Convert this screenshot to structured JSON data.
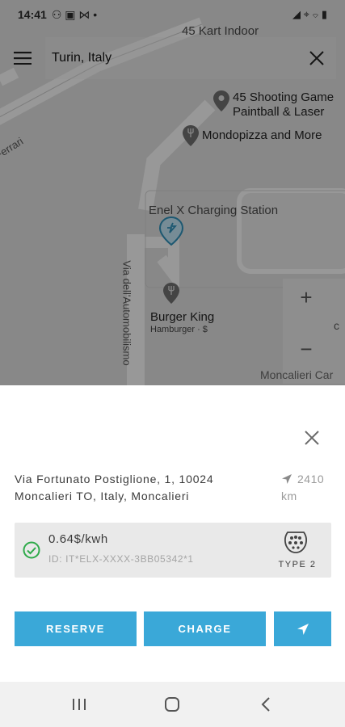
{
  "status_bar": {
    "time": "14:41",
    "indicators": "⚇ ▣ ⋈ •",
    "system": "◢ ⌖ ⌔ ▮"
  },
  "search": {
    "value": "Turin, Italy"
  },
  "map": {
    "pois": [
      {
        "name": "45 Kart Indoor"
      },
      {
        "name": "45 Shooting Game",
        "name2": "Paintball & Laser"
      },
      {
        "name": "Mondopizza and More"
      },
      {
        "name": "Enel X Charging Station"
      },
      {
        "name": "Burger King",
        "sub": "Hamburger · $"
      }
    ],
    "streets": [
      "Ferrari",
      "Via dell'Automobilismo",
      "Moncalieri Car"
    ],
    "zoom_in": "+",
    "zoom_out": "−",
    "edge_letter": "c"
  },
  "station": {
    "address": "Via Fortunato Postiglione, 1, 10024 Moncalieri TO, Italy, Moncalieri",
    "distance": "2410 km",
    "price": "0.64$/kwh",
    "id": "ID: IT*ELX-XXXX-3BB05342*1",
    "plug_type": "TYPE 2",
    "accent_color": "#3aa8d8",
    "status_color": "#2eaa4a"
  },
  "actions": {
    "reserve": "RESERVE",
    "charge": "CHARGE"
  }
}
